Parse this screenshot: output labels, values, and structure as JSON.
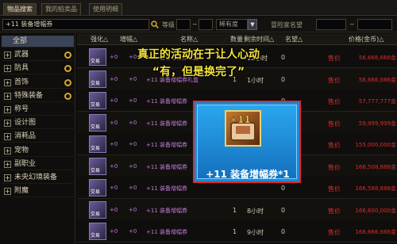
{
  "tabs": [
    "物品搜索",
    "我的拍卖品",
    "使用明细"
  ],
  "filter": {
    "search_value": "+11 装备增幅券",
    "level_label": "等级",
    "level_sep": "~",
    "rarity_label": "稀有度",
    "seller_label": "冒险家名望",
    "seller_sep": "~"
  },
  "sidebar": {
    "items": [
      {
        "label": "全部",
        "plus": ""
      },
      {
        "label": "武器",
        "plus": "+"
      },
      {
        "label": "防具",
        "plus": "+"
      },
      {
        "label": "首饰",
        "plus": "+"
      },
      {
        "label": "特殊装备",
        "plus": "+"
      },
      {
        "label": "称号",
        "plus": "+"
      },
      {
        "label": "设计图",
        "plus": "+"
      },
      {
        "label": "消耗品",
        "plus": "+"
      },
      {
        "label": "宠物",
        "plus": "+"
      },
      {
        "label": "副职业",
        "plus": "+"
      },
      {
        "label": "未央幻境装备",
        "plus": "+"
      },
      {
        "label": "附魔",
        "plus": "+"
      }
    ]
  },
  "columns": [
    "强化△",
    "增幅△",
    "名称△",
    "数量",
    "剩余时间△",
    "名望△",
    "价格(金币)△"
  ],
  "rows": [
    {
      "icon": "交易",
      "str": "+0",
      "amp": "+0",
      "name": "+11 装备增幅券礼盒",
      "qty": "",
      "time": "12小时",
      "req": "0",
      "sell": "售价",
      "price": "56,666,666金"
    },
    {
      "icon": "交易",
      "str": "+0",
      "amp": "+0",
      "name": "+11 装备增幅券礼盒",
      "qty": "1",
      "time": "1小时",
      "req": "0",
      "sell": "售价",
      "price": "56,666,666金"
    },
    {
      "icon": "交易",
      "str": "+0",
      "amp": "+0",
      "name": "+11 装备增幅券",
      "qty": "",
      "time": "",
      "req": "0",
      "sell": "售价",
      "price": "57,777,777金"
    },
    {
      "icon": "交易",
      "str": "+0",
      "amp": "+0",
      "name": "+11 装备增幅券",
      "qty": "",
      "time": "",
      "req": "0",
      "sell": "售价",
      "price": "59,999,999金"
    },
    {
      "icon": "交易",
      "str": "+0",
      "amp": "+0",
      "name": "+11 装备增幅券",
      "qty": "",
      "time": "",
      "req": "0",
      "sell": "售价",
      "price": "155,000,000金"
    },
    {
      "icon": "交易",
      "str": "+0",
      "amp": "+0",
      "name": "+11 装备增幅券",
      "qty": "",
      "time": "",
      "req": "0",
      "sell": "售价",
      "price": "166,508,888金"
    },
    {
      "icon": "交易",
      "str": "+0",
      "amp": "+0",
      "name": "+11 装备增幅券",
      "qty": "",
      "time": "",
      "req": "0",
      "sell": "售价",
      "price": "166,588,888金"
    },
    {
      "icon": "交易",
      "str": "+0",
      "amp": "+0",
      "name": "+11 装备增幅券",
      "qty": "1",
      "time": "8小时",
      "req": "0",
      "sell": "售价",
      "price": "166,600,000金"
    },
    {
      "icon": "交易",
      "str": "+0",
      "amp": "+0",
      "name": "+11 装备增幅券",
      "qty": "1",
      "time": "9小时",
      "req": "0",
      "sell": "售价",
      "price": "166,666,666金"
    }
  ],
  "overlay": {
    "line1": "真正的活动在于让人心动",
    "line2": "“有，但是换完了”"
  },
  "popup": {
    "label": "+11 装备增幅券*1"
  }
}
